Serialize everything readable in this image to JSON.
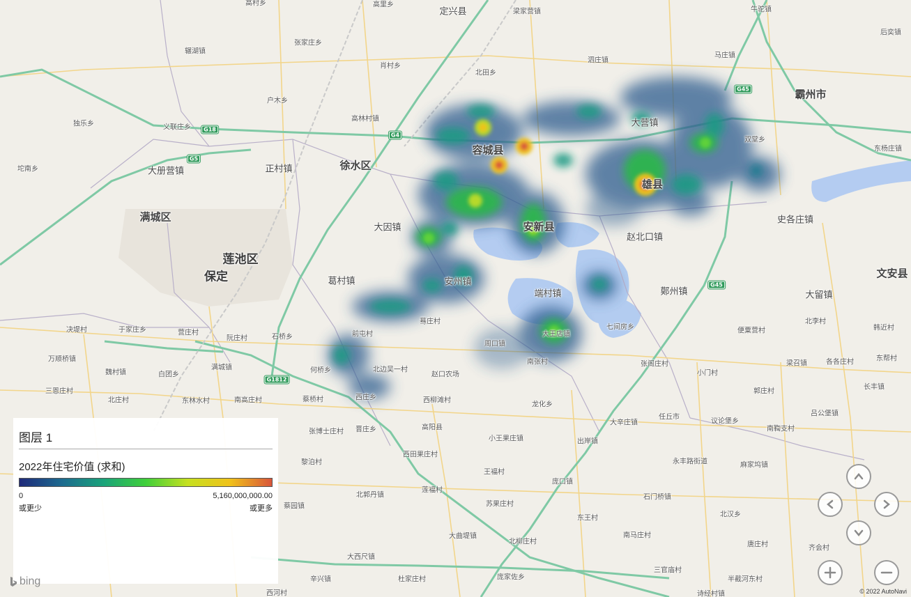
{
  "legend": {
    "layer_title": "图层 1",
    "field_label": "2022年住宅价值 (求和)",
    "min_value": "0",
    "max_value": "5,160,000,000.00",
    "min_note": "或更少",
    "max_note": "或更多",
    "gradient_colors": [
      "#1f2a7a",
      "#1d6a8f",
      "#1aa37a",
      "#3fcf3a",
      "#c6e020",
      "#f0c21a",
      "#d8553a"
    ]
  },
  "map": {
    "attribution_logo": "bing",
    "copyright": "© 2022 AutoNavi",
    "places": {
      "districts": [
        {
          "id": "lianchi",
          "name": "莲池区"
        },
        {
          "id": "baoding",
          "name": "保定"
        },
        {
          "id": "mancheng",
          "name": "满城区"
        },
        {
          "id": "xushui",
          "name": "徐水区"
        },
        {
          "id": "bazhou",
          "name": "霸州市"
        },
        {
          "id": "wenan",
          "name": "文安县"
        }
      ],
      "counties": [
        {
          "id": "anxin",
          "name": "安新县"
        },
        {
          "id": "rongcheng",
          "name": "容城县"
        },
        {
          "id": "xiongxian",
          "name": "雄县"
        },
        {
          "id": "anzhou",
          "name": "安州镇"
        },
        {
          "id": "dingxing",
          "name": "定兴县"
        },
        {
          "id": "gaoyang",
          "name": "高阳县"
        },
        {
          "id": "renqiu",
          "name": "任丘市"
        }
      ],
      "towns": [
        {
          "id": "gaoshan",
          "name": "高村乡"
        },
        {
          "id": "gaoli",
          "name": "高里乡"
        },
        {
          "id": "liangjiaying",
          "name": "梁家营镇"
        },
        {
          "id": "niutuo",
          "name": "牛驼镇"
        },
        {
          "id": "zhangjiazhuang",
          "name": "张家庄乡"
        },
        {
          "id": "yaohu",
          "name": "辗湖镇"
        },
        {
          "id": "shichun",
          "name": "肖村乡"
        },
        {
          "id": "beitian",
          "name": "北田乡"
        },
        {
          "id": "sizhuang",
          "name": "泗庄镇"
        },
        {
          "id": "mazhuang",
          "name": "马庄镇"
        },
        {
          "id": "houyi",
          "name": "后奕镇"
        },
        {
          "id": "humu",
          "name": "户木乡"
        },
        {
          "id": "gaolin",
          "name": "高林村镇"
        },
        {
          "id": "dule",
          "name": "独乐乡"
        },
        {
          "id": "yilian",
          "name": "义联庄乡"
        },
        {
          "id": "zhengcun",
          "name": "正村镇"
        },
        {
          "id": "dacying",
          "name": "大册营镇"
        },
        {
          "id": "wanan",
          "name": "坨南乡"
        },
        {
          "id": "dayingzhen",
          "name": "大营镇"
        },
        {
          "id": "shuangtang",
          "name": "双堂乡"
        },
        {
          "id": "dongyang",
          "name": "东杨庄镇"
        },
        {
          "id": "shige",
          "name": "史各庄镇"
        },
        {
          "id": "dayin",
          "name": "大因镇"
        },
        {
          "id": "zhaobeikou",
          "name": "赵北口镇"
        },
        {
          "id": "gecun",
          "name": "葛村镇"
        },
        {
          "id": "duancun",
          "name": "端村镇"
        },
        {
          "id": "maozhou",
          "name": "鄚州镇"
        },
        {
          "id": "daliu",
          "name": "大留镇"
        }
      ],
      "villages": [
        {
          "id": "v1",
          "name": "决堤村"
        },
        {
          "id": "v2",
          "name": "于家庄乡"
        },
        {
          "id": "v3",
          "name": "营庄村"
        },
        {
          "id": "v4",
          "name": "阮庄村"
        },
        {
          "id": "v5",
          "name": "石桥乡"
        },
        {
          "id": "v6",
          "name": "前屯村"
        },
        {
          "id": "v7",
          "name": "蓦庄村"
        },
        {
          "id": "v8",
          "name": "周口镇"
        },
        {
          "id": "v9",
          "name": "大王店镇"
        },
        {
          "id": "v10",
          "name": "七间房乡"
        },
        {
          "id": "v11",
          "name": "便粟营村"
        },
        {
          "id": "v12",
          "name": "北李村"
        },
        {
          "id": "v13",
          "name": "韩近村"
        },
        {
          "id": "v14",
          "name": "万顺桥镇"
        },
        {
          "id": "v15",
          "name": "魏村镇"
        },
        {
          "id": "v16",
          "name": "白团乡"
        },
        {
          "id": "v17",
          "name": "满城镇"
        },
        {
          "id": "v18",
          "name": "何桥乡"
        },
        {
          "id": "v19",
          "name": "北边吴一村"
        },
        {
          "id": "v20",
          "name": "赵口农场"
        },
        {
          "id": "v21",
          "name": "南张村"
        },
        {
          "id": "v22",
          "name": "张阁庄村"
        },
        {
          "id": "v23",
          "name": "小门村"
        },
        {
          "id": "v24",
          "name": "梁召镇"
        },
        {
          "id": "v25",
          "name": "各各庄村"
        },
        {
          "id": "v26",
          "name": "东帮村"
        },
        {
          "id": "v27",
          "name": "三恩庄村"
        },
        {
          "id": "v28",
          "name": "北庄村"
        },
        {
          "id": "v29",
          "name": "东林水村"
        },
        {
          "id": "v30",
          "name": "南高庄村"
        },
        {
          "id": "v31",
          "name": "蔡桥村"
        },
        {
          "id": "v32",
          "name": "西庄乡"
        },
        {
          "id": "v33",
          "name": "西柳滩村"
        },
        {
          "id": "v34",
          "name": "龙化乡"
        },
        {
          "id": "v35",
          "name": "郭庄村"
        },
        {
          "id": "v36",
          "name": "长丰镇"
        },
        {
          "id": "v37",
          "name": "大辛庄镇"
        },
        {
          "id": "v38",
          "name": "议论堡乡"
        },
        {
          "id": "v39",
          "name": "吕公堡镇"
        },
        {
          "id": "v40",
          "name": "张博士庄村"
        },
        {
          "id": "v41",
          "name": "晋庄乡"
        },
        {
          "id": "v42",
          "name": "小王果庄镇"
        },
        {
          "id": "v43",
          "name": "出岸镇"
        },
        {
          "id": "v44",
          "name": "西田果庄村"
        },
        {
          "id": "v45",
          "name": "永丰路街道"
        },
        {
          "id": "v46",
          "name": "南鞫支村"
        },
        {
          "id": "v47",
          "name": "麻家坞镇"
        },
        {
          "id": "v48",
          "name": "黎泊村"
        },
        {
          "id": "v49",
          "name": "王福村"
        },
        {
          "id": "v50",
          "name": "庞口镇"
        },
        {
          "id": "v51",
          "name": "北郭丹镇"
        },
        {
          "id": "v52",
          "name": "莲福村"
        },
        {
          "id": "v53",
          "name": "苏果庄村"
        },
        {
          "id": "v54",
          "name": "东王村"
        },
        {
          "id": "v55",
          "name": "石门桥镇"
        },
        {
          "id": "v56",
          "name": "北汉乡"
        },
        {
          "id": "v57",
          "name": "蔡园镇"
        },
        {
          "id": "v58",
          "name": "大曲堤镇"
        },
        {
          "id": "v59",
          "name": "北柳庄村"
        },
        {
          "id": "v60",
          "name": "南马庄村"
        },
        {
          "id": "v61",
          "name": "唐庄村"
        },
        {
          "id": "v62",
          "name": "齐会村"
        },
        {
          "id": "v63",
          "name": "大西尺镇"
        },
        {
          "id": "v64",
          "name": "辛兴镇"
        },
        {
          "id": "v65",
          "name": "杜家庄村"
        },
        {
          "id": "v66",
          "name": "庞家佐乡"
        },
        {
          "id": "v67",
          "name": "三官庙村"
        },
        {
          "id": "v68",
          "name": "半截河东村"
        },
        {
          "id": "v69",
          "name": "西河村"
        },
        {
          "id": "v70",
          "name": "诗经村镇"
        }
      ],
      "shields": [
        "G18",
        "G4",
        "G5",
        "G45",
        "G1812",
        "G45"
      ]
    }
  },
  "controls": {
    "pan_up": "pan-up",
    "pan_left": "pan-left",
    "pan_right": "pan-right",
    "pan_down": "pan-down",
    "zoom_in": "+",
    "zoom_out": "−"
  }
}
